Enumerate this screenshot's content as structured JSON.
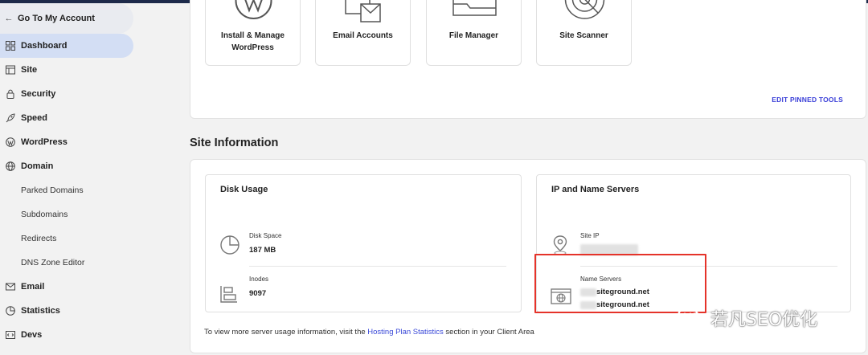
{
  "sidebar": {
    "back_label": "Go To My Account",
    "items": [
      {
        "label": "Dashboard",
        "icon": "dashboard-icon"
      },
      {
        "label": "Site",
        "icon": "site-icon"
      },
      {
        "label": "Security",
        "icon": "lock-icon"
      },
      {
        "label": "Speed",
        "icon": "rocket-icon"
      },
      {
        "label": "WordPress",
        "icon": "wordpress-icon"
      },
      {
        "label": "Domain",
        "icon": "globe-icon"
      },
      {
        "label": "Email",
        "icon": "envelope-icon"
      },
      {
        "label": "Statistics",
        "icon": "pie-chart-icon"
      },
      {
        "label": "Devs",
        "icon": "code-icon"
      }
    ],
    "domain_subitems": [
      "Parked Domains",
      "Subdomains",
      "Redirects",
      "DNS Zone Editor"
    ],
    "active_color": "#d3def4"
  },
  "tools": {
    "items": [
      {
        "label": "Install & Manage WordPress",
        "icon": "wordpress-icon"
      },
      {
        "label": "Email Accounts",
        "icon": "email-accounts-icon"
      },
      {
        "label": "File Manager",
        "icon": "folder-icon"
      },
      {
        "label": "Site Scanner",
        "icon": "radar-icon"
      }
    ],
    "edit_label": "EDIT PINNED TOOLS"
  },
  "site_information": {
    "title": "Site Information",
    "disk": {
      "title": "Disk Usage",
      "disk_space_label": "Disk Space",
      "disk_space_value": "187 MB",
      "inodes_label": "Inodes",
      "inodes_value": "9097"
    },
    "ip": {
      "title": "IP and Name Servers",
      "site_ip_label": "Site IP",
      "name_servers_label": "Name Servers",
      "name_servers": [
        "siteground.net",
        "siteground.net"
      ]
    },
    "footer": {
      "prefix": "To view more server usage information, visit the ",
      "link": "Hosting Plan Statistics",
      "suffix": " section in your Client Area"
    }
  },
  "watermark": "若凡SEO优化",
  "colors": {
    "accent_link": "#3a3fd8",
    "highlight_border": "#e5332a",
    "top_bar": "#1d2a4a"
  }
}
